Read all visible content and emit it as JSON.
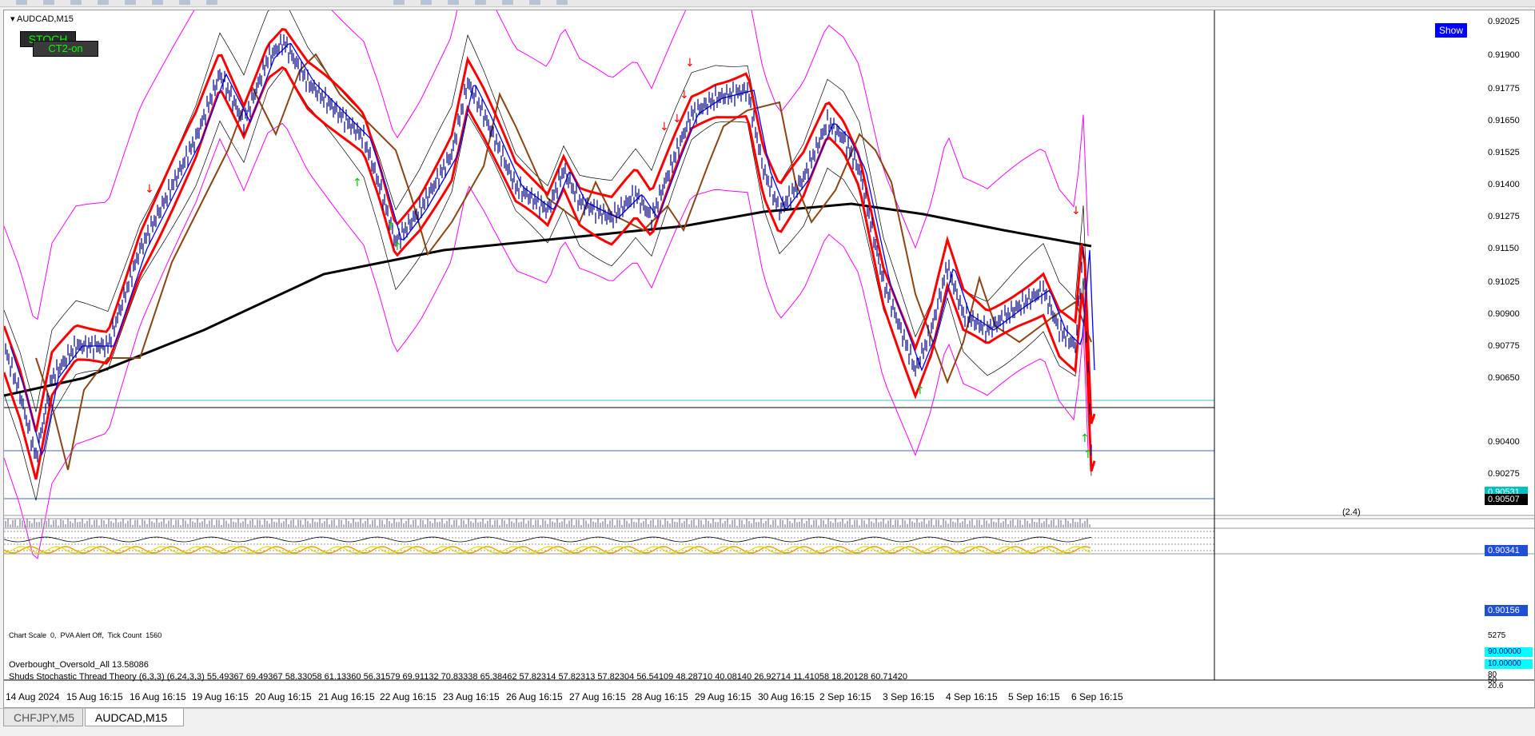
{
  "toolbar": {
    "items": [
      "new",
      "open",
      "save",
      "print",
      "cut",
      "copy",
      "paste",
      "undo",
      "zoom-in",
      "zoom-out",
      "line",
      "cursor",
      "crosshair",
      "period",
      "template"
    ]
  },
  "chart": {
    "symbol": "AUDCAD,M15",
    "stoch_button": "STOCH",
    "ct_button": "CT2-on",
    "show_button": "Show",
    "price_axis": [
      "0.92025",
      "0.91900",
      "0.91775",
      "0.91650",
      "0.91525",
      "0.91400",
      "0.91275",
      "0.91150",
      "0.91025",
      "0.90900",
      "0.90775",
      "0.90650",
      "0.90400",
      "0.90275"
    ],
    "tags": {
      "price_cyan": "0.90531",
      "price_current": "0.90507",
      "price_blue1": "0.90341",
      "price_blue2": "0.90156"
    },
    "delta": "(2.4)",
    "colors": {
      "red_band": "#ff0000",
      "magenta_band": "#ff00ff",
      "black_ma": "#000000",
      "brown_ma": "#8b4513",
      "blue_ma": "#0000ff",
      "candles": "#000080",
      "green_arrows": "#00c000"
    }
  },
  "info": {
    "chart_scale": "Chart Scale  0,",
    "pva": "PVA Alert Off,",
    "tick_count": "Tick Count  1560"
  },
  "volume_panel": {
    "max_label": "5275"
  },
  "osc_panel": {
    "overbought_label": "Overbought_Oversold_All 13.58086",
    "tag1": "90.00000",
    "tag2": "10.00000",
    "stoch_label": "Shuds Stochastic Thread Theory (6,3,3) (6,24,3,3) 55.49367 69.49367 58.33058 61.13360 56.31579 69.91132 70.83338 65.38462 57.82314 57.82313 57.82304 56.54109 48.28710 40.08140 26.92714 11.41058 18.20128 60.71420",
    "small_labels": [
      "80",
      "50",
      "20.6"
    ]
  },
  "time_axis": [
    "14 Aug 2024",
    "15 Aug 16:15",
    "16 Aug 16:15",
    "19 Aug 16:15",
    "20 Aug 16:15",
    "21 Aug 16:15",
    "22 Aug 16:15",
    "23 Aug 16:15",
    "26 Aug 16:15",
    "27 Aug 16:15",
    "28 Aug 16:15",
    "29 Aug 16:15",
    "30 Aug 16:15",
    "2 Sep 16:15",
    "3 Sep 16:15",
    "4 Sep 16:15",
    "5 Sep 16:15",
    "6 Sep 16:15"
  ],
  "tabs": [
    {
      "label": "CHFJPY,M5",
      "active": false
    },
    {
      "label": "AUDCAD,M15",
      "active": true
    }
  ]
}
